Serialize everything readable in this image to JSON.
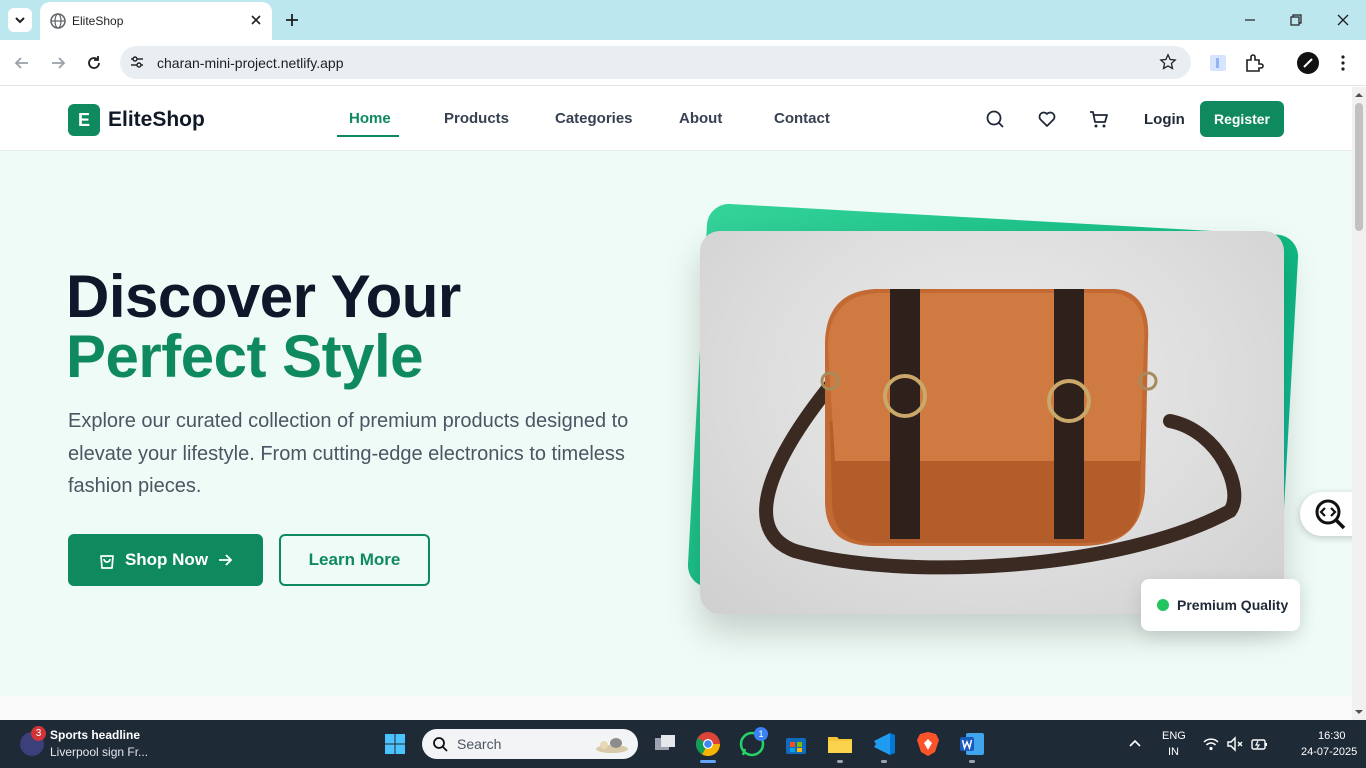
{
  "browser": {
    "tab_title": "EliteShop",
    "url": "charan-mini-project.netlify.app"
  },
  "site": {
    "logo_letter": "E",
    "logo_text": "EliteShop",
    "nav": [
      "Home",
      "Products",
      "Categories",
      "About",
      "Contact"
    ],
    "active_nav": "Home",
    "login_label": "Login",
    "register_label": "Register",
    "brand_color": "#0f8a5f"
  },
  "hero": {
    "title_line1": "Discover Your",
    "title_line2": "Perfect Style",
    "description": "Explore our curated collection of premium products designed to elevate your lifestyle. From cutting-edge electronics to timeless fashion pieces.",
    "primary_cta": "Shop Now",
    "secondary_cta": "Learn More",
    "badge_label": "Premium Quality",
    "image_subject": "brown leather messenger bag"
  },
  "taskbar": {
    "news_title": "Sports headline",
    "news_subtitle": "Liverpool sign Fr...",
    "news_badge": "3",
    "search_placeholder": "Search",
    "whatsapp_badge": "1",
    "lang_line1": "ENG",
    "lang_line2": "IN",
    "time": "16:30",
    "date": "24-07-2025"
  }
}
